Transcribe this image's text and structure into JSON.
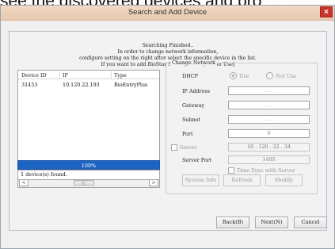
{
  "heading": "see the discovered devices and pro",
  "window": {
    "title": "Search and Add Device",
    "close_glyph": "×"
  },
  "status": {
    "line1": "Searching Finished..",
    "line2": "In order to change network information,",
    "line3": "configure setting on the right after select the specific device in the list.",
    "line4": "If you want to add BioStar Server, check [Server Use]"
  },
  "device_list": {
    "columns": [
      "Device ID",
      "IP",
      "Type"
    ],
    "rows": [
      {
        "device_id": "31453",
        "ip": "10.120.22.193",
        "type": "BioEntryPlus"
      }
    ],
    "scroll_left": "<",
    "scroll_right": ">"
  },
  "progress": {
    "value_percent": 100,
    "label": "100%"
  },
  "found_text": "1 device(s) found.",
  "network": {
    "group_label": "Change Network",
    "dhcp_label": "DHCP",
    "dhcp_use": "Use",
    "dhcp_not_use": "Not Use",
    "ip_label": "IP Address",
    "ip_value": ". . .",
    "gateway_label": "Gateway",
    "gateway_value": ". . .",
    "subnet_label": "Subnet",
    "subnet_value": ". . .",
    "port_label": "Port",
    "port_value": "0",
    "server_label": "Server",
    "server_value": "10 . 120 . 22 . 34",
    "server_port_label": "Server Port",
    "server_port_value": "1480",
    "time_sync_label": "Time Sync with Server",
    "system_info": "System Info",
    "refresh": "Refresh",
    "modify": "Modify"
  },
  "footer": {
    "back": "Back(B)",
    "next": "Next(N)",
    "cancel": "Cancel"
  }
}
